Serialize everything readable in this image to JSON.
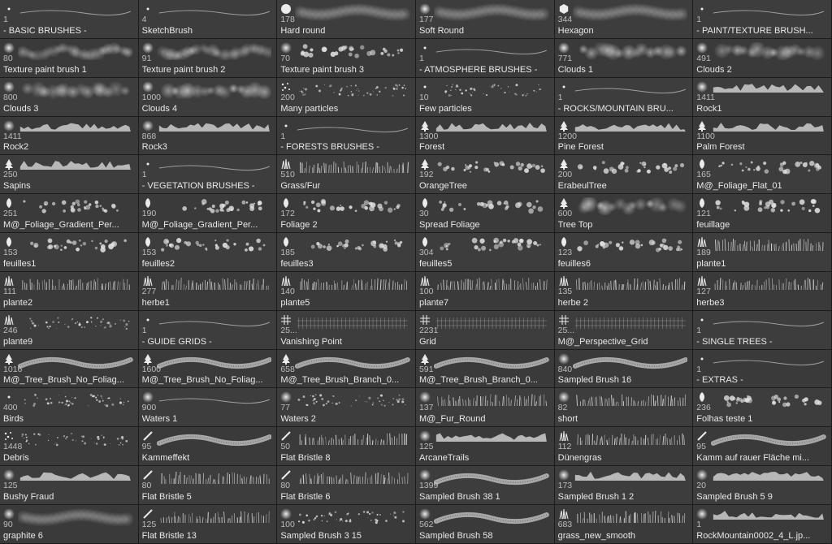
{
  "brushes": [
    {
      "size": "1",
      "name": "- BASIC BRUSHES -",
      "tip": "dot",
      "stroke": "thin"
    },
    {
      "size": "4",
      "name": "SketchBrush",
      "tip": "dot",
      "stroke": "thin"
    },
    {
      "size": "178",
      "name": "Hard round",
      "tip": "disc",
      "stroke": "soft"
    },
    {
      "size": "177",
      "name": "Soft Round",
      "tip": "blur",
      "stroke": "soft"
    },
    {
      "size": "344",
      "name": "Hexagon",
      "tip": "hex",
      "stroke": "soft"
    },
    {
      "size": "1",
      "name": "- PAINT/TEXTURE BRUSH... ",
      "tip": "dot",
      "stroke": "thin"
    },
    {
      "size": "80",
      "name": "Texture paint brush 1",
      "tip": "blur",
      "stroke": "texture"
    },
    {
      "size": "91",
      "name": "Texture paint brush 2",
      "tip": "blur",
      "stroke": "texture"
    },
    {
      "size": "70",
      "name": "Texture paint brush 3",
      "tip": "blur",
      "stroke": "scatter"
    },
    {
      "size": "1",
      "name": "- ATMOSPHERE BRUSHES -",
      "tip": "dot",
      "stroke": "thin"
    },
    {
      "size": "771",
      "name": "Clouds 1",
      "tip": "blur",
      "stroke": "cloud"
    },
    {
      "size": "491",
      "name": "Clouds 2",
      "tip": "blur",
      "stroke": "cloud"
    },
    {
      "size": "800",
      "name": "Clouds 3",
      "tip": "blur",
      "stroke": "cloud"
    },
    {
      "size": "1000",
      "name": "Clouds 4",
      "tip": "blur",
      "stroke": "cloud"
    },
    {
      "size": "200",
      "name": "Many particles",
      "tip": "dots",
      "stroke": "dots"
    },
    {
      "size": "10",
      "name": "Few particles",
      "tip": "dot",
      "stroke": "dots"
    },
    {
      "size": "1",
      "name": "- ROCKS/MOUNTAIN BRU...",
      "tip": "dot",
      "stroke": "thin"
    },
    {
      "size": "1411",
      "name": "Rock1",
      "tip": "blur",
      "stroke": "rough"
    },
    {
      "size": "1411",
      "name": "Rock2",
      "tip": "blur",
      "stroke": "rough"
    },
    {
      "size": "868",
      "name": "Rock3",
      "tip": "blur",
      "stroke": "rough"
    },
    {
      "size": "1",
      "name": "- FORESTS BRUSHES -",
      "tip": "dot",
      "stroke": "thin"
    },
    {
      "size": "1300",
      "name": "Forest",
      "tip": "tree",
      "stroke": "rough"
    },
    {
      "size": "1200",
      "name": "Pine Forest",
      "tip": "tree",
      "stroke": "rough"
    },
    {
      "size": "1100",
      "name": "Palm Forest",
      "tip": "tree",
      "stroke": "rough"
    },
    {
      "size": "250",
      "name": "Sapins",
      "tip": "tree",
      "stroke": "rough"
    },
    {
      "size": "1",
      "name": "- VEGETATION BRUSHES -",
      "tip": "dot",
      "stroke": "thin"
    },
    {
      "size": "510",
      "name": "Grass/Fur",
      "tip": "grass",
      "stroke": "bristle"
    },
    {
      "size": "192",
      "name": "OrangeTree",
      "tip": "tree",
      "stroke": "scatter"
    },
    {
      "size": "200",
      "name": "ErabeulTree",
      "tip": "tree",
      "stroke": "scatter"
    },
    {
      "size": "165",
      "name": "M@_Foliage_Flat_01",
      "tip": "leaf",
      "stroke": "scatter"
    },
    {
      "size": "251",
      "name": "M@_Foliage_Gradient_Per...",
      "tip": "leaf",
      "stroke": "scatter"
    },
    {
      "size": "190",
      "name": "M@_Foliage_Gradient_Per...",
      "tip": "leaf",
      "stroke": "scatter"
    },
    {
      "size": "172",
      "name": "Foliage 2",
      "tip": "leaf",
      "stroke": "scatter"
    },
    {
      "size": "30",
      "name": "Spread Foliage",
      "tip": "leaf",
      "stroke": "scatter"
    },
    {
      "size": "600",
      "name": "Tree Top",
      "tip": "tree",
      "stroke": "cloud"
    },
    {
      "size": "121",
      "name": "feuillage",
      "tip": "leaf",
      "stroke": "scatter"
    },
    {
      "size": "153",
      "name": "feuilles1",
      "tip": "leaf",
      "stroke": "scatter"
    },
    {
      "size": "153",
      "name": "feuilles2",
      "tip": "leaf",
      "stroke": "scatter"
    },
    {
      "size": "185",
      "name": "feuilles3",
      "tip": "leaf",
      "stroke": "scatter"
    },
    {
      "size": "304",
      "name": "feuilles5",
      "tip": "leaf",
      "stroke": "scatter"
    },
    {
      "size": "123",
      "name": "feuilles6",
      "tip": "leaf",
      "stroke": "scatter"
    },
    {
      "size": "189",
      "name": "plante1",
      "tip": "grass",
      "stroke": "bristle"
    },
    {
      "size": "111",
      "name": "plante2",
      "tip": "grass",
      "stroke": "bristle"
    },
    {
      "size": "277",
      "name": "herbe1",
      "tip": "grass",
      "stroke": "bristle"
    },
    {
      "size": "140",
      "name": "plante5",
      "tip": "grass",
      "stroke": "bristle"
    },
    {
      "size": "100",
      "name": "plante7",
      "tip": "grass",
      "stroke": "bristle"
    },
    {
      "size": "135",
      "name": "herbe 2",
      "tip": "grass",
      "stroke": "bristle"
    },
    {
      "size": "127",
      "name": "herbe3",
      "tip": "grass",
      "stroke": "bristle"
    },
    {
      "size": "246",
      "name": "plante9",
      "tip": "grass",
      "stroke": "dots"
    },
    {
      "size": "1",
      "name": "- GUIDE GRIDS -",
      "tip": "dot",
      "stroke": "thin"
    },
    {
      "size": "25...",
      "name": "Vanishing Point",
      "tip": "grid",
      "stroke": "grid"
    },
    {
      "size": "2231",
      "name": "Grid",
      "tip": "grid",
      "stroke": "grid"
    },
    {
      "size": "25...",
      "name": "M@_Perspective_Grid",
      "tip": "grid",
      "stroke": "grid"
    },
    {
      "size": "1",
      "name": "- SINGLE TREES -",
      "tip": "dot",
      "stroke": "thin"
    },
    {
      "size": "1016",
      "name": "M@_Tree_Brush_No_Foliag...",
      "tip": "tree",
      "stroke": "wave"
    },
    {
      "size": "1600",
      "name": "M@_Tree_Brush_No_Foliag...",
      "tip": "tree",
      "stroke": "wave"
    },
    {
      "size": "658",
      "name": "M@_Tree_Brush_Branch_0...",
      "tip": "tree",
      "stroke": "wave"
    },
    {
      "size": "591",
      "name": "M@_Tree_Brush_Branch_0...",
      "tip": "tree",
      "stroke": "wave"
    },
    {
      "size": "840",
      "name": "Sampled Brush 16",
      "tip": "blur",
      "stroke": "wave"
    },
    {
      "size": "1",
      "name": "- EXTRAS -",
      "tip": "dot",
      "stroke": "thin"
    },
    {
      "size": "400",
      "name": "Birds",
      "tip": "dot",
      "stroke": "dots"
    },
    {
      "size": "900",
      "name": "Waters 1",
      "tip": "blur",
      "stroke": "thin"
    },
    {
      "size": "77",
      "name": "Waters 2",
      "tip": "blur",
      "stroke": "dots"
    },
    {
      "size": "137",
      "name": "M@_Fur_Round",
      "tip": "blur",
      "stroke": "bristle"
    },
    {
      "size": "82",
      "name": "short",
      "tip": "blur",
      "stroke": "bristle"
    },
    {
      "size": "236",
      "name": "Folhas teste 1",
      "tip": "leaf",
      "stroke": "scatter"
    },
    {
      "size": "1448",
      "name": "Debris",
      "tip": "dots",
      "stroke": "dots"
    },
    {
      "size": "95",
      "name": "Kammeffekt",
      "tip": "line",
      "stroke": "wave"
    },
    {
      "size": "50",
      "name": "Flat Bristle 8",
      "tip": "line",
      "stroke": "bristle"
    },
    {
      "size": "125",
      "name": "ArcaneTrails",
      "tip": "blur",
      "stroke": "rough"
    },
    {
      "size": "112",
      "name": "Dünengras",
      "tip": "grass",
      "stroke": "bristle"
    },
    {
      "size": "95",
      "name": "Kamm auf rauer Fläche mi...",
      "tip": "line",
      "stroke": "wave"
    },
    {
      "size": "125",
      "name": "Bushy Fraud",
      "tip": "blur",
      "stroke": "rough"
    },
    {
      "size": "80",
      "name": "Flat Bristle 5",
      "tip": "line",
      "stroke": "bristle"
    },
    {
      "size": "80",
      "name": "Flat Bristle 6",
      "tip": "line",
      "stroke": "bristle"
    },
    {
      "size": "1399",
      "name": "Sampled Brush 38 1",
      "tip": "blur",
      "stroke": "wave"
    },
    {
      "size": "173",
      "name": "Sampled Brush 1 2",
      "tip": "blur",
      "stroke": "rough"
    },
    {
      "size": "20",
      "name": "Sampled Brush 5 9",
      "tip": "blur",
      "stroke": "rough"
    },
    {
      "size": "90",
      "name": "graphite 6",
      "tip": "blur",
      "stroke": "soft"
    },
    {
      "size": "125",
      "name": "Flat Bristle 13",
      "tip": "line",
      "stroke": "bristle"
    },
    {
      "size": "100",
      "name": "Sampled Brush 3 15",
      "tip": "blur",
      "stroke": "dots"
    },
    {
      "size": "562",
      "name": "Sampled Brush 58",
      "tip": "blur",
      "stroke": "wave"
    },
    {
      "size": "683",
      "name": "grass_new_smooth",
      "tip": "grass",
      "stroke": "bristle"
    },
    {
      "size": "1",
      "name": "RockMountain0002_4_L.jp...",
      "tip": "blur",
      "stroke": "rough"
    }
  ]
}
